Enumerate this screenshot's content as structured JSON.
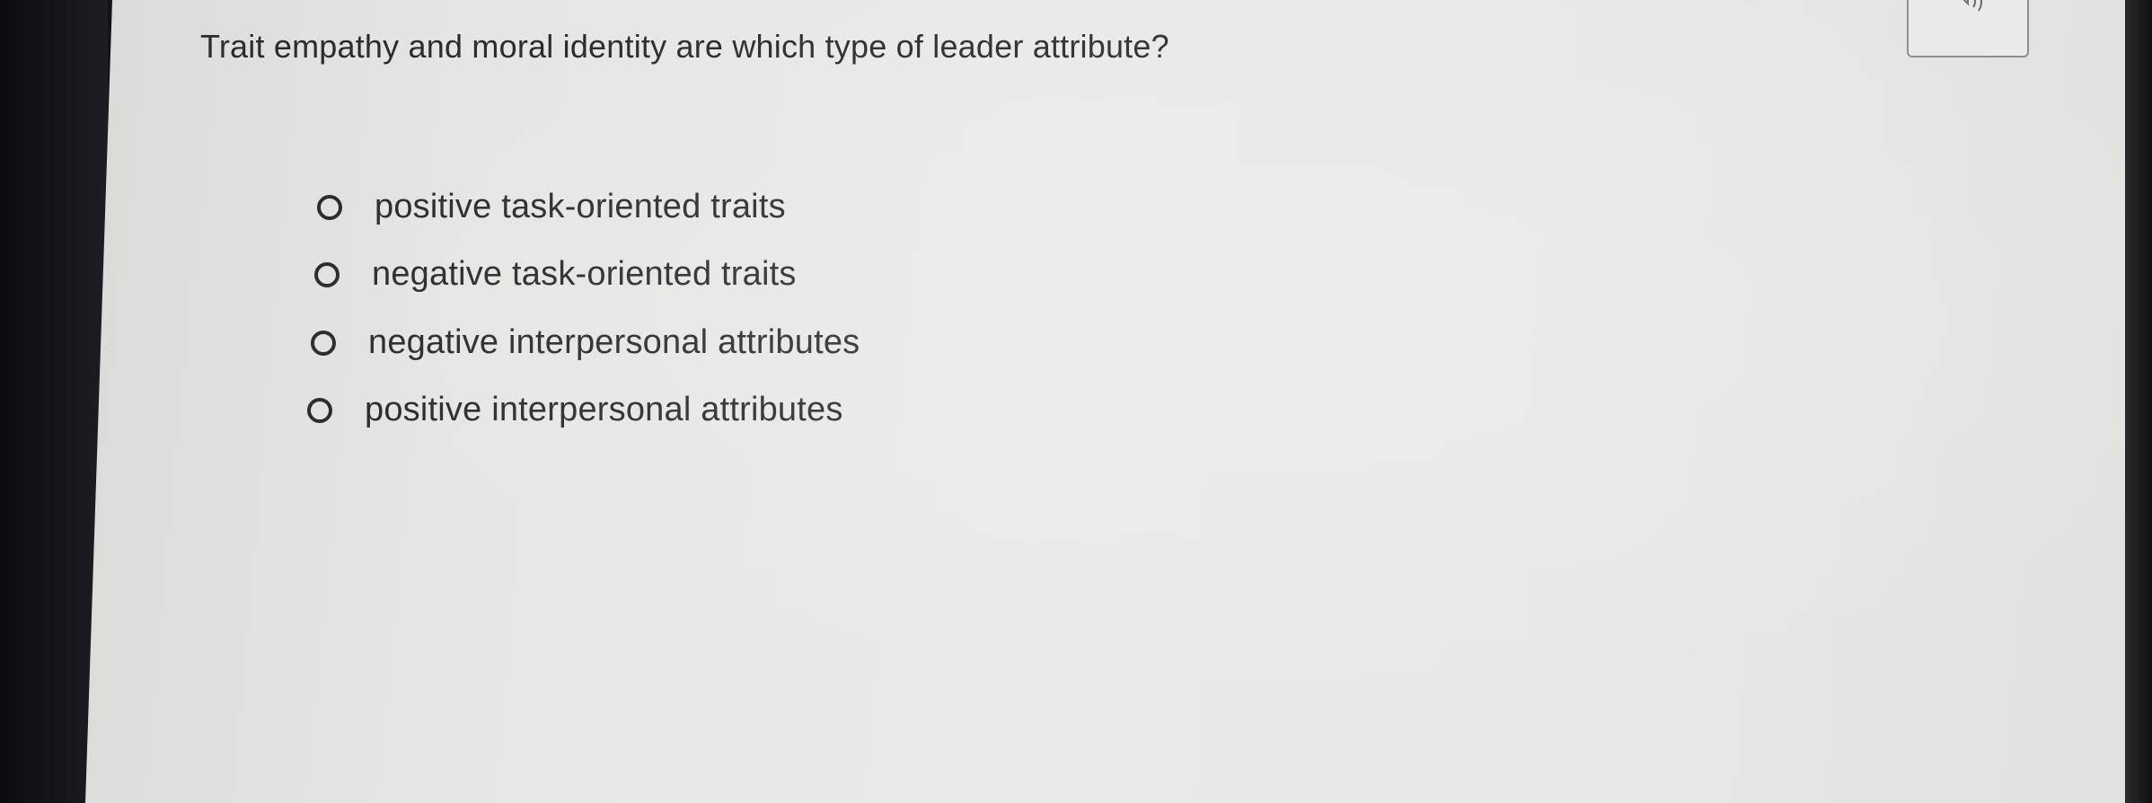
{
  "question": {
    "text": "Trait empathy and moral identity are which type of leader attribute?"
  },
  "audio": {
    "icon": "speaker-icon"
  },
  "options": [
    {
      "label": "positive task-oriented traits",
      "selected": false
    },
    {
      "label": "negative task-oriented traits",
      "selected": false
    },
    {
      "label": "negative interpersonal attributes",
      "selected": false
    },
    {
      "label": "positive interpersonal attributes",
      "selected": false
    }
  ],
  "colors": {
    "text": "#2b2c2e",
    "background": "#e6e7e4",
    "bezel": "#141416"
  }
}
